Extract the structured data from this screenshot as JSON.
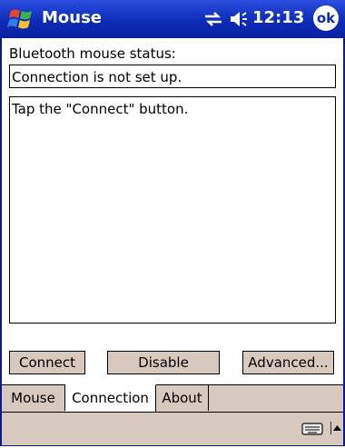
{
  "title_bar": {
    "app_title": "Mouse",
    "clock": "12:13",
    "ok_label": "ok"
  },
  "main": {
    "status_label": "Bluetooth mouse status:",
    "status_value": "Connection is not set up.",
    "message": "Tap the \"Connect\" button."
  },
  "buttons": {
    "connect": "Connect",
    "disable": "Disable",
    "advanced": "Advanced..."
  },
  "tabs": [
    {
      "label": "Mouse"
    },
    {
      "label": "Connection",
      "selected": true
    },
    {
      "label": "About"
    }
  ],
  "colors": {
    "title_bar": "#0d2bb8",
    "button_face": "#d8c9bf"
  },
  "icons": {
    "start": "windows-flag-icon",
    "connectivity": "connectivity-icon",
    "volume": "speaker-icon",
    "input": "keyboard-icon",
    "input_menu": "up-arrow-icon"
  }
}
